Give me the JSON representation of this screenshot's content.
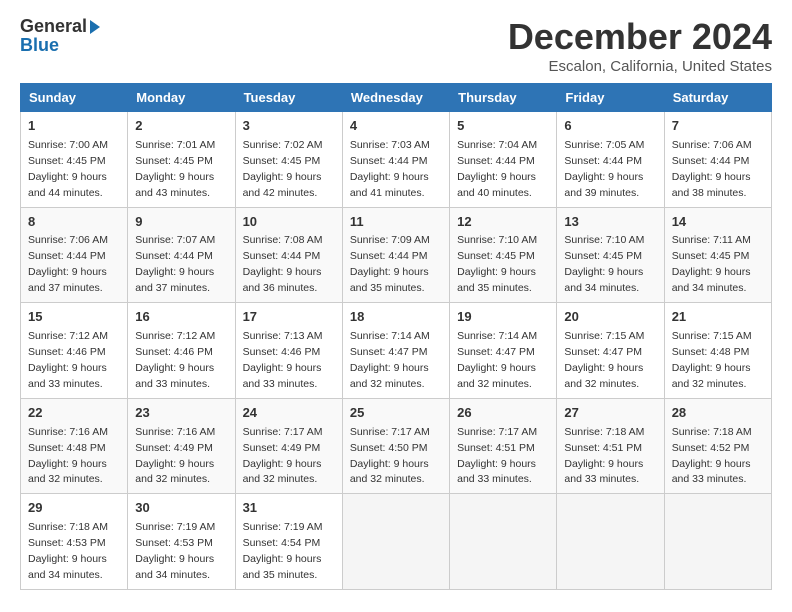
{
  "header": {
    "logo_general": "General",
    "logo_blue": "Blue",
    "month_title": "December 2024",
    "location": "Escalon, California, United States"
  },
  "days_of_week": [
    "Sunday",
    "Monday",
    "Tuesday",
    "Wednesday",
    "Thursday",
    "Friday",
    "Saturday"
  ],
  "weeks": [
    [
      {
        "day": "1",
        "sunrise": "7:00 AM",
        "sunset": "4:45 PM",
        "daylight": "9 hours and 44 minutes."
      },
      {
        "day": "2",
        "sunrise": "7:01 AM",
        "sunset": "4:45 PM",
        "daylight": "9 hours and 43 minutes."
      },
      {
        "day": "3",
        "sunrise": "7:02 AM",
        "sunset": "4:45 PM",
        "daylight": "9 hours and 42 minutes."
      },
      {
        "day": "4",
        "sunrise": "7:03 AM",
        "sunset": "4:44 PM",
        "daylight": "9 hours and 41 minutes."
      },
      {
        "day": "5",
        "sunrise": "7:04 AM",
        "sunset": "4:44 PM",
        "daylight": "9 hours and 40 minutes."
      },
      {
        "day": "6",
        "sunrise": "7:05 AM",
        "sunset": "4:44 PM",
        "daylight": "9 hours and 39 minutes."
      },
      {
        "day": "7",
        "sunrise": "7:06 AM",
        "sunset": "4:44 PM",
        "daylight": "9 hours and 38 minutes."
      }
    ],
    [
      {
        "day": "8",
        "sunrise": "7:06 AM",
        "sunset": "4:44 PM",
        "daylight": "9 hours and 37 minutes."
      },
      {
        "day": "9",
        "sunrise": "7:07 AM",
        "sunset": "4:44 PM",
        "daylight": "9 hours and 37 minutes."
      },
      {
        "day": "10",
        "sunrise": "7:08 AM",
        "sunset": "4:44 PM",
        "daylight": "9 hours and 36 minutes."
      },
      {
        "day": "11",
        "sunrise": "7:09 AM",
        "sunset": "4:44 PM",
        "daylight": "9 hours and 35 minutes."
      },
      {
        "day": "12",
        "sunrise": "7:10 AM",
        "sunset": "4:45 PM",
        "daylight": "9 hours and 35 minutes."
      },
      {
        "day": "13",
        "sunrise": "7:10 AM",
        "sunset": "4:45 PM",
        "daylight": "9 hours and 34 minutes."
      },
      {
        "day": "14",
        "sunrise": "7:11 AM",
        "sunset": "4:45 PM",
        "daylight": "9 hours and 34 minutes."
      }
    ],
    [
      {
        "day": "15",
        "sunrise": "7:12 AM",
        "sunset": "4:46 PM",
        "daylight": "9 hours and 33 minutes."
      },
      {
        "day": "16",
        "sunrise": "7:12 AM",
        "sunset": "4:46 PM",
        "daylight": "9 hours and 33 minutes."
      },
      {
        "day": "17",
        "sunrise": "7:13 AM",
        "sunset": "4:46 PM",
        "daylight": "9 hours and 33 minutes."
      },
      {
        "day": "18",
        "sunrise": "7:14 AM",
        "sunset": "4:47 PM",
        "daylight": "9 hours and 32 minutes."
      },
      {
        "day": "19",
        "sunrise": "7:14 AM",
        "sunset": "4:47 PM",
        "daylight": "9 hours and 32 minutes."
      },
      {
        "day": "20",
        "sunrise": "7:15 AM",
        "sunset": "4:47 PM",
        "daylight": "9 hours and 32 minutes."
      },
      {
        "day": "21",
        "sunrise": "7:15 AM",
        "sunset": "4:48 PM",
        "daylight": "9 hours and 32 minutes."
      }
    ],
    [
      {
        "day": "22",
        "sunrise": "7:16 AM",
        "sunset": "4:48 PM",
        "daylight": "9 hours and 32 minutes."
      },
      {
        "day": "23",
        "sunrise": "7:16 AM",
        "sunset": "4:49 PM",
        "daylight": "9 hours and 32 minutes."
      },
      {
        "day": "24",
        "sunrise": "7:17 AM",
        "sunset": "4:49 PM",
        "daylight": "9 hours and 32 minutes."
      },
      {
        "day": "25",
        "sunrise": "7:17 AM",
        "sunset": "4:50 PM",
        "daylight": "9 hours and 32 minutes."
      },
      {
        "day": "26",
        "sunrise": "7:17 AM",
        "sunset": "4:51 PM",
        "daylight": "9 hours and 33 minutes."
      },
      {
        "day": "27",
        "sunrise": "7:18 AM",
        "sunset": "4:51 PM",
        "daylight": "9 hours and 33 minutes."
      },
      {
        "day": "28",
        "sunrise": "7:18 AM",
        "sunset": "4:52 PM",
        "daylight": "9 hours and 33 minutes."
      }
    ],
    [
      {
        "day": "29",
        "sunrise": "7:18 AM",
        "sunset": "4:53 PM",
        "daylight": "9 hours and 34 minutes."
      },
      {
        "day": "30",
        "sunrise": "7:19 AM",
        "sunset": "4:53 PM",
        "daylight": "9 hours and 34 minutes."
      },
      {
        "day": "31",
        "sunrise": "7:19 AM",
        "sunset": "4:54 PM",
        "daylight": "9 hours and 35 minutes."
      },
      null,
      null,
      null,
      null
    ]
  ],
  "labels": {
    "sunrise_prefix": "Sunrise: ",
    "sunset_prefix": "Sunset: ",
    "daylight_label": "Daylight: "
  }
}
